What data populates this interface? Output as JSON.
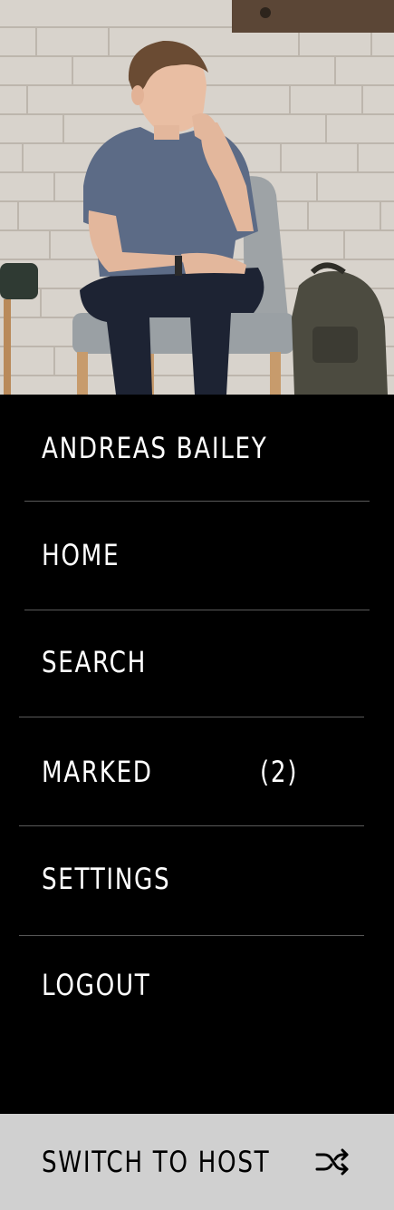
{
  "profile": {
    "name": "ANDREAS BAILEY"
  },
  "menu": {
    "items": [
      {
        "label": "HOME"
      },
      {
        "label": "SEARCH"
      },
      {
        "label": "MARKED",
        "count": "(2)"
      },
      {
        "label": "SETTINGS"
      },
      {
        "label": "LOGOUT"
      }
    ]
  },
  "footer": {
    "switch_label": "SWITCH TO HOST",
    "icon": "shuffle-icon"
  },
  "colors": {
    "menu_background": "#000000",
    "menu_text": "#ffffff",
    "divider": "#5a5a5a",
    "footer_background": "#d0d0d0",
    "footer_text": "#000000"
  }
}
